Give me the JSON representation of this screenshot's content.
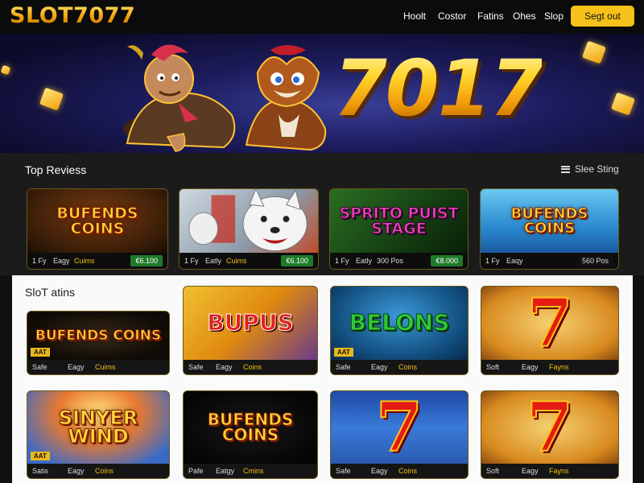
{
  "header": {
    "logo": "SLOT7077",
    "nav": [
      "Hoolt",
      "Costor",
      "Fatins",
      "Ohes",
      "Slop"
    ],
    "cta_label": "Segt out"
  },
  "hero": {
    "headline": "7017"
  },
  "top_reviews": {
    "title": "Top Reviess",
    "see_all_label": "Slee Sting",
    "cards": [
      {
        "title": "BUFENDS COINS",
        "m1": "1 Fy",
        "m2": "Eagy",
        "m3": "Cuims",
        "price": "€6.100",
        "price_style": "green"
      },
      {
        "title": "",
        "m1": "1 Fy",
        "m2": "Eatly",
        "m3": "Cuims",
        "price": "€6.100",
        "price_style": "green"
      },
      {
        "title": "SPRITO PUIST STAGE",
        "m1": "1 Fy",
        "m2": "Eatly",
        "m3": "300 Pos",
        "price": "€8.000",
        "price_style": "green"
      },
      {
        "title": "BUFENDS COINS",
        "m1": "1 Fy",
        "m2": "Eaqy",
        "m3": "",
        "price": "560 Pos",
        "price_style": "dark"
      }
    ]
  },
  "slot_games": {
    "title": "SloT atins",
    "cards": [
      {
        "title": "BUFENDS COINS",
        "badge": "AAT",
        "m1": "Safe",
        "m2": "Eagy",
        "m3": "Cuims"
      },
      {
        "title": "BUPUS",
        "badge": "",
        "m1": "Safe",
        "m2": "Eagy",
        "m3": "Coins"
      },
      {
        "title": "BELONS",
        "badge": "AAT",
        "m1": "Safe",
        "m2": "Eagy",
        "m3": "Coins"
      },
      {
        "title": "7",
        "badge": "",
        "m1": "Soft",
        "m2": "Eagy",
        "m3": "Fayns"
      },
      {
        "title": "SINYER WIND",
        "badge": "AAT",
        "m1": "Satis",
        "m2": "Eagy",
        "m3": "Coins"
      },
      {
        "title": "BUFENDS COINS",
        "badge": "",
        "m1": "Pafe",
        "m2": "Eatgy",
        "m3": "Cmins"
      },
      {
        "title": "7",
        "badge": "",
        "m1": "Safe",
        "m2": "Eagy",
        "m3": "Coins"
      },
      {
        "title": "7",
        "badge": "",
        "m1": "Soft",
        "m2": "Eagy",
        "m3": "Fayns"
      }
    ]
  },
  "colors": {
    "accent": "#f6c11a",
    "header_bg": "#0b0b0b",
    "dark_section_bg": "#1b1b1b",
    "light_section_bg": "#fafafa",
    "price_green": "#1f7a2a"
  }
}
